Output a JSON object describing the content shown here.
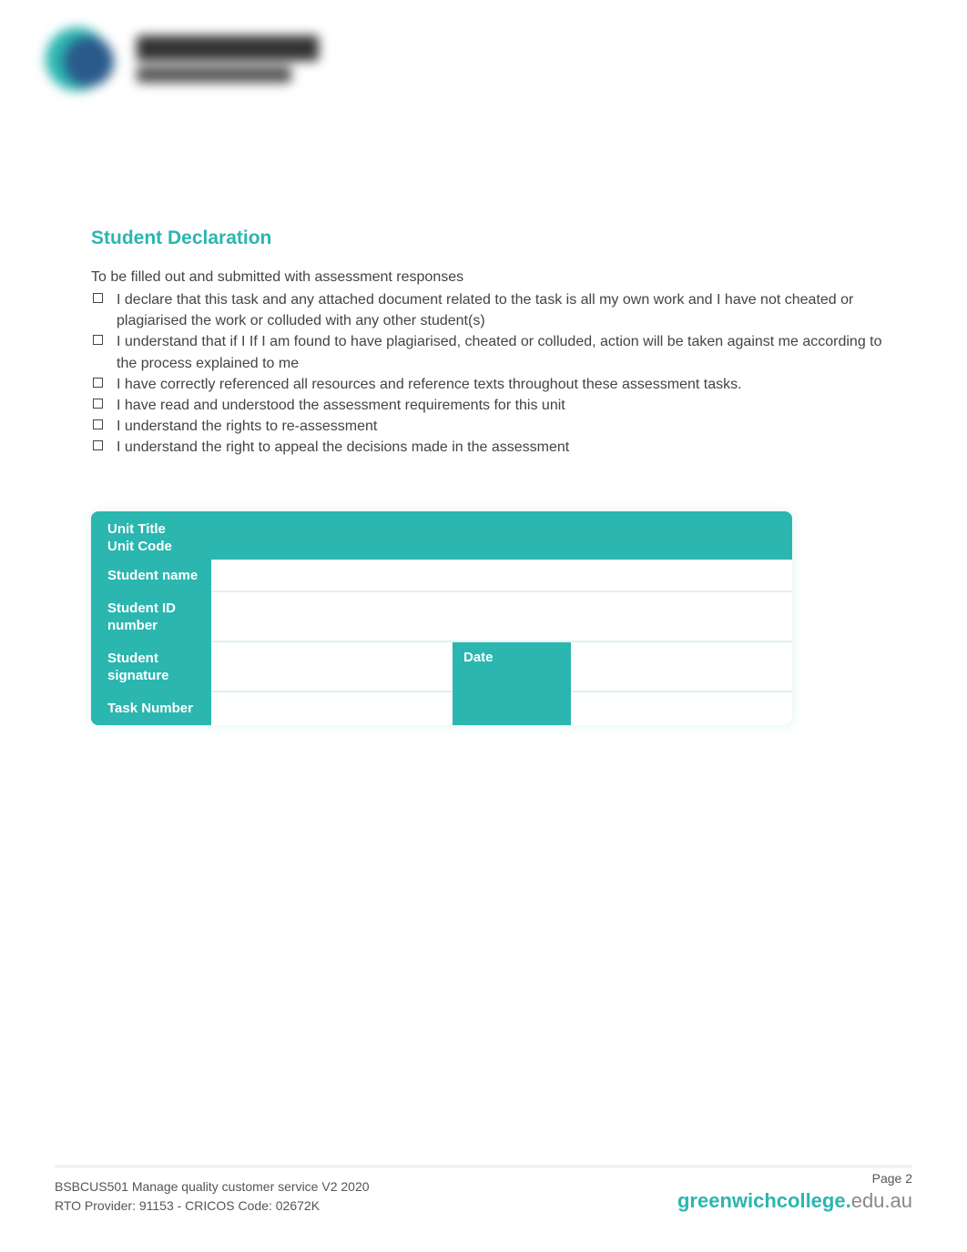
{
  "heading": "Student Declaration",
  "intro": "To be filled out and submitted with assessment responses",
  "declarations": [
    "I declare that this task and any attached document related to the task is all my own work and I have not cheated or plagiarised the work or colluded with any other student(s)",
    "I understand that if I If I am found to have plagiarised, cheated or colluded, action will be taken against me according to the process explained to me",
    "I have correctly referenced all resources and reference texts throughout these assessment tasks.",
    "I have read and understood the assessment requirements for this unit",
    "I understand the rights to re-assessment",
    "I understand the right to appeal the decisions made in the assessment"
  ],
  "form": {
    "unit_title_label": "Unit Title",
    "unit_code_label": "Unit Code",
    "student_name_label": "Student name",
    "student_id_label": "Student ID number",
    "student_signature_label": "Student signature",
    "date_label": "Date",
    "task_number_label": "Task Number",
    "unit_title_value": "",
    "unit_code_value": "",
    "student_name_value": "",
    "student_id_value": "",
    "student_signature_value": "",
    "date_value": "",
    "task_number_value": "",
    "task_number_value2": ""
  },
  "footer": {
    "line1": "BSBCUS501 Manage quality customer service V2 2020",
    "line2": "RTO Provider: 91153  - CRICOS  Code: 02672K",
    "page": "Page 2",
    "site_bold": "greenwichcollege.",
    "site_rest": "edu.au"
  }
}
